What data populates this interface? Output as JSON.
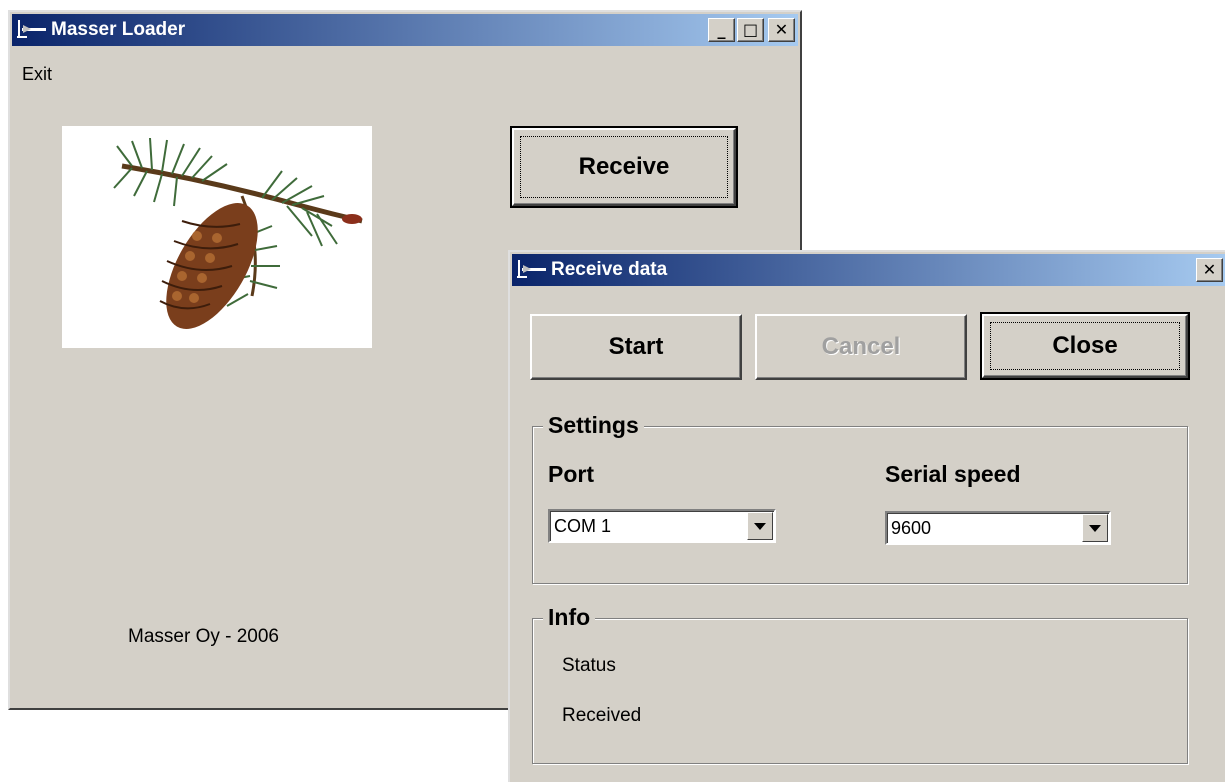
{
  "main_window": {
    "title": "Masser Loader",
    "menu": {
      "exit_label": "Exit"
    },
    "receive_button": "Receive",
    "footer": "Masser Oy - 2006",
    "caption_buttons": {
      "minimize": "_",
      "maximize": "□",
      "close": "✕"
    }
  },
  "dialog": {
    "title": "Receive data",
    "close_glyph": "✕",
    "buttons": {
      "start": "Start",
      "cancel": "Cancel",
      "close": "Close"
    },
    "settings": {
      "group_label": "Settings",
      "port_label": "Port",
      "port_value": "COM 1",
      "speed_label": "Serial speed",
      "speed_value": "9600"
    },
    "info": {
      "group_label": "Info",
      "status_label": "Status",
      "received_label": "Received"
    }
  },
  "colors": {
    "titlebar_start": "#0a246a",
    "titlebar_end": "#a6caf0",
    "window_face": "#d4d0c8"
  },
  "icons": {
    "app": "plane-app-icon",
    "image": "pine-cone-branch-image",
    "dropdown": "chevron-down-icon"
  }
}
